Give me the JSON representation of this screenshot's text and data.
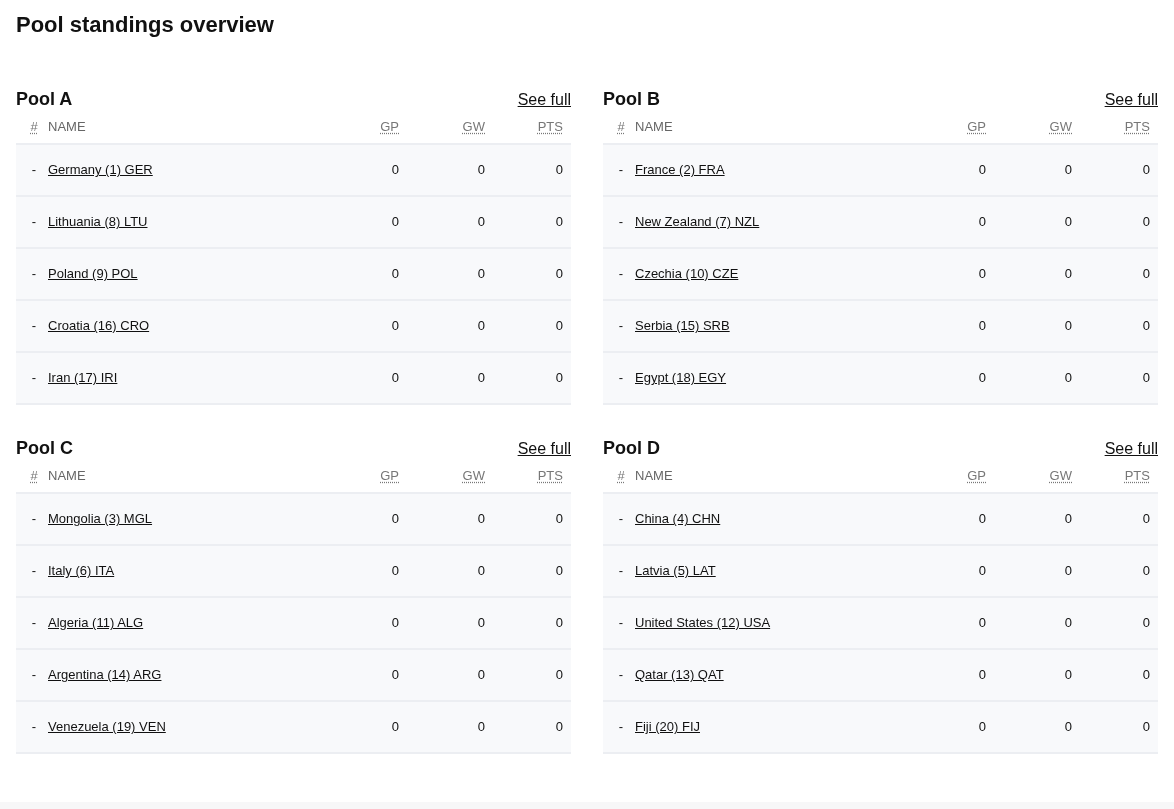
{
  "title": "Pool standings overview",
  "pools": [
    {
      "name": "Pool A",
      "link": "See full",
      "columns": [
        {
          "label": "#",
          "abbreviated": true
        },
        {
          "label": "NAME",
          "abbreviated": false
        },
        {
          "label": "GP",
          "abbreviated": true
        },
        {
          "label": "GW",
          "abbreviated": true
        },
        {
          "label": "PTS",
          "abbreviated": true
        }
      ],
      "rows": [
        {
          "cells": [
            "-",
            "Germany (1) GER",
            "0",
            "0",
            "0"
          ]
        },
        {
          "cells": [
            "-",
            "Lithuania (8) LTU",
            "0",
            "0",
            "0"
          ]
        },
        {
          "cells": [
            "-",
            "Poland (9) POL",
            "0",
            "0",
            "0"
          ]
        },
        {
          "cells": [
            "-",
            "Croatia (16) CRO",
            "0",
            "0",
            "0"
          ]
        },
        {
          "cells": [
            "-",
            "Iran (17) IRI",
            "0",
            "0",
            "0"
          ]
        }
      ]
    },
    {
      "name": "Pool B",
      "link": "See full",
      "columns": [
        {
          "label": "#",
          "abbreviated": true
        },
        {
          "label": "NAME",
          "abbreviated": false
        },
        {
          "label": "GP",
          "abbreviated": true
        },
        {
          "label": "GW",
          "abbreviated": true
        },
        {
          "label": "PTS",
          "abbreviated": true
        }
      ],
      "rows": [
        {
          "cells": [
            "-",
            "France (2) FRA",
            "0",
            "0",
            "0"
          ]
        },
        {
          "cells": [
            "-",
            "New Zealand (7) NZL",
            "0",
            "0",
            "0"
          ]
        },
        {
          "cells": [
            "-",
            "Czechia (10) CZE",
            "0",
            "0",
            "0"
          ]
        },
        {
          "cells": [
            "-",
            "Serbia (15) SRB",
            "0",
            "0",
            "0"
          ]
        },
        {
          "cells": [
            "-",
            "Egypt (18) EGY",
            "0",
            "0",
            "0"
          ]
        }
      ]
    },
    {
      "name": "Pool C",
      "link": "See full",
      "columns": [
        {
          "label": "#",
          "abbreviated": true
        },
        {
          "label": "NAME",
          "abbreviated": false
        },
        {
          "label": "GP",
          "abbreviated": true
        },
        {
          "label": "GW",
          "abbreviated": true
        },
        {
          "label": "PTS",
          "abbreviated": true
        }
      ],
      "rows": [
        {
          "cells": [
            "-",
            "Mongolia (3) MGL",
            "0",
            "0",
            "0"
          ]
        },
        {
          "cells": [
            "-",
            "Italy (6) ITA",
            "0",
            "0",
            "0"
          ]
        },
        {
          "cells": [
            "-",
            "Algeria (11) ALG",
            "0",
            "0",
            "0"
          ]
        },
        {
          "cells": [
            "-",
            "Argentina (14) ARG",
            "0",
            "0",
            "0"
          ]
        },
        {
          "cells": [
            "-",
            "Venezuela (19) VEN",
            "0",
            "0",
            "0"
          ]
        }
      ]
    },
    {
      "name": "Pool D",
      "link": "See full",
      "columns": [
        {
          "label": "#",
          "abbreviated": true
        },
        {
          "label": "NAME",
          "abbreviated": false
        },
        {
          "label": "GP",
          "abbreviated": true
        },
        {
          "label": "GW",
          "abbreviated": true
        },
        {
          "label": "PTS",
          "abbreviated": true
        }
      ],
      "rows": [
        {
          "cells": [
            "-",
            "China (4) CHN",
            "0",
            "0",
            "0"
          ]
        },
        {
          "cells": [
            "-",
            "Latvia (5) LAT",
            "0",
            "0",
            "0"
          ]
        },
        {
          "cells": [
            "-",
            "United States (12) USA",
            "0",
            "0",
            "0"
          ]
        },
        {
          "cells": [
            "-",
            "Qatar (13) QAT",
            "0",
            "0",
            "0"
          ]
        },
        {
          "cells": [
            "-",
            "Fiji (20) FIJ",
            "0",
            "0",
            "0"
          ]
        }
      ]
    }
  ]
}
